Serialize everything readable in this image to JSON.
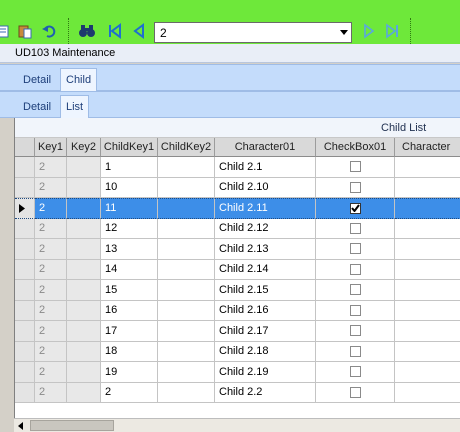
{
  "toolbar": {
    "nav_value": "2",
    "icons": [
      "new-icon",
      "paste-icon",
      "undo-icon",
      "binoculars-icon",
      "first-record-icon",
      "prev-record-icon",
      "next-record-icon",
      "last-record-icon"
    ]
  },
  "window": {
    "title": "UD103 Maintenance"
  },
  "tabs_primary": [
    "Detail",
    "Child"
  ],
  "tabs_secondary": [
    "Detail",
    "List"
  ],
  "grid": {
    "group_label": "Child List",
    "columns": [
      "Key1",
      "Key2",
      "ChildKey1",
      "ChildKey2",
      "Character01",
      "CheckBox01",
      "Character"
    ],
    "rows": [
      {
        "key1": "2",
        "key2": "",
        "childkey1": "1",
        "childkey2": "",
        "char01": "Child 2.1",
        "checked": false
      },
      {
        "key1": "2",
        "key2": "",
        "childkey1": "10",
        "childkey2": "",
        "char01": "Child 2.10",
        "checked": false
      },
      {
        "key1": "2",
        "key2": "",
        "childkey1": "11",
        "childkey2": "",
        "char01": "Child 2.11",
        "checked": true,
        "selected": true
      },
      {
        "key1": "2",
        "key2": "",
        "childkey1": "12",
        "childkey2": "",
        "char01": "Child 2.12",
        "checked": false
      },
      {
        "key1": "2",
        "key2": "",
        "childkey1": "13",
        "childkey2": "",
        "char01": "Child 2.13",
        "checked": false
      },
      {
        "key1": "2",
        "key2": "",
        "childkey1": "14",
        "childkey2": "",
        "char01": "Child 2.14",
        "checked": false
      },
      {
        "key1": "2",
        "key2": "",
        "childkey1": "15",
        "childkey2": "",
        "char01": "Child 2.15",
        "checked": false
      },
      {
        "key1": "2",
        "key2": "",
        "childkey1": "16",
        "childkey2": "",
        "char01": "Child 2.16",
        "checked": false
      },
      {
        "key1": "2",
        "key2": "",
        "childkey1": "17",
        "childkey2": "",
        "char01": "Child 2.17",
        "checked": false
      },
      {
        "key1": "2",
        "key2": "",
        "childkey1": "18",
        "childkey2": "",
        "char01": "Child 2.18",
        "checked": false
      },
      {
        "key1": "2",
        "key2": "",
        "childkey1": "19",
        "childkey2": "",
        "char01": "Child 2.19",
        "checked": false
      },
      {
        "key1": "2",
        "key2": "",
        "childkey1": "2",
        "childkey2": "",
        "char01": "Child 2.2",
        "checked": false
      }
    ]
  },
  "colors": {
    "toolbar_bg": "#6ee83a",
    "selection": "#3d8ee8",
    "tab_strip": "#c4dcfb"
  }
}
